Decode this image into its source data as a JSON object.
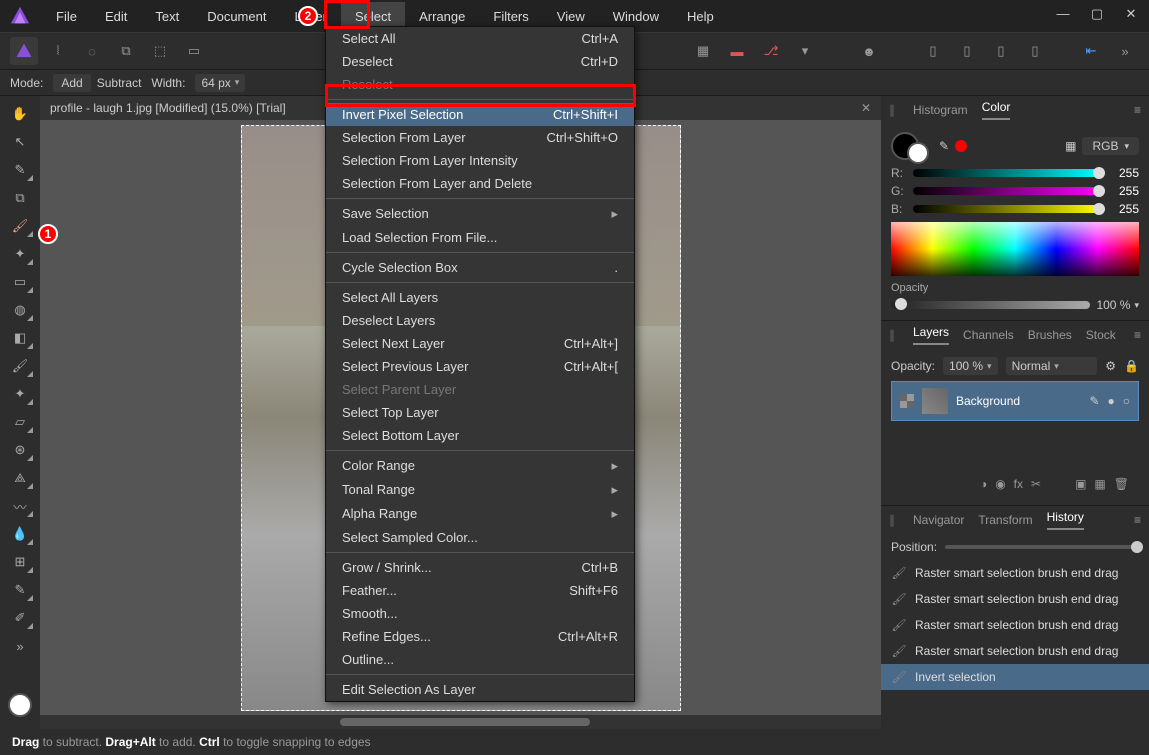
{
  "menubar": [
    "File",
    "Edit",
    "Text",
    "Document",
    "Layer",
    "Select",
    "Arrange",
    "Filters",
    "View",
    "Window",
    "Help"
  ],
  "menubar_active_index": 5,
  "toolbar": {
    "mode_label": "Mode:",
    "add": "Add",
    "subtract": "Subtract",
    "width_label": "Width:",
    "width_value": "64 px"
  },
  "tab": {
    "title": "profile - laugh 1.jpg [Modified] (15.0%) [Trial]"
  },
  "select_menu": {
    "items": [
      {
        "label": "Select All",
        "shortcut": "Ctrl+A"
      },
      {
        "label": "Deselect",
        "shortcut": "Ctrl+D"
      },
      {
        "label": "Reselect",
        "disabled": true
      },
      {
        "sep": true
      },
      {
        "label": "Invert Pixel Selection",
        "shortcut": "Ctrl+Shift+I",
        "highlight": true
      },
      {
        "label": "Selection From Layer",
        "shortcut": "Ctrl+Shift+O"
      },
      {
        "label": "Selection From Layer Intensity"
      },
      {
        "label": "Selection From Layer and Delete"
      },
      {
        "sep": true
      },
      {
        "label": "Save Selection",
        "submenu": true
      },
      {
        "label": "Load Selection From File..."
      },
      {
        "sep": true
      },
      {
        "label": "Cycle Selection Box",
        "shortcut": "."
      },
      {
        "sep": true
      },
      {
        "label": "Select All Layers"
      },
      {
        "label": "Deselect Layers"
      },
      {
        "label": "Select Next Layer",
        "shortcut": "Ctrl+Alt+]"
      },
      {
        "label": "Select Previous Layer",
        "shortcut": "Ctrl+Alt+["
      },
      {
        "label": "Select Parent Layer",
        "disabled": true
      },
      {
        "label": "Select Top Layer"
      },
      {
        "label": "Select Bottom Layer"
      },
      {
        "sep": true
      },
      {
        "label": "Color Range",
        "submenu": true
      },
      {
        "label": "Tonal Range",
        "submenu": true
      },
      {
        "label": "Alpha Range",
        "submenu": true
      },
      {
        "label": "Select Sampled Color..."
      },
      {
        "sep": true
      },
      {
        "label": "Grow / Shrink...",
        "shortcut": "Ctrl+B"
      },
      {
        "label": "Feather...",
        "shortcut": "Shift+F6"
      },
      {
        "label": "Smooth..."
      },
      {
        "label": "Refine Edges...",
        "shortcut": "Ctrl+Alt+R"
      },
      {
        "label": "Outline..."
      },
      {
        "sep": true
      },
      {
        "label": "Edit Selection As Layer"
      }
    ]
  },
  "panels": {
    "top": {
      "tabs": [
        "Histogram",
        "Color"
      ],
      "active": 1,
      "model": "RGB",
      "channels": [
        {
          "l": "R:",
          "v": "255"
        },
        {
          "l": "G:",
          "v": "255"
        },
        {
          "l": "B:",
          "v": "255"
        }
      ],
      "opacity_label": "Opacity",
      "opacity_value": "100 %"
    },
    "mid": {
      "tabs": [
        "Layers",
        "Channels",
        "Brushes",
        "Stock"
      ],
      "active": 0,
      "opacity_label": "Opacity:",
      "opacity_value": "100 %",
      "blend": "Normal",
      "layer_name": "Background"
    },
    "bot": {
      "tabs": [
        "Navigator",
        "Transform",
        "History"
      ],
      "active": 2,
      "position_label": "Position:",
      "history": [
        "Raster smart selection brush end drag",
        "Raster smart selection brush end drag",
        "Raster smart selection brush end drag",
        "Raster smart selection brush end drag",
        "Invert selection"
      ],
      "history_active": 4
    }
  },
  "status": {
    "prefix1": "Drag",
    "text1": " to subtract. ",
    "prefix2": "Drag+Alt",
    "text2": " to add. ",
    "prefix3": "Ctrl",
    "text3": " to toggle snapping to edges"
  }
}
